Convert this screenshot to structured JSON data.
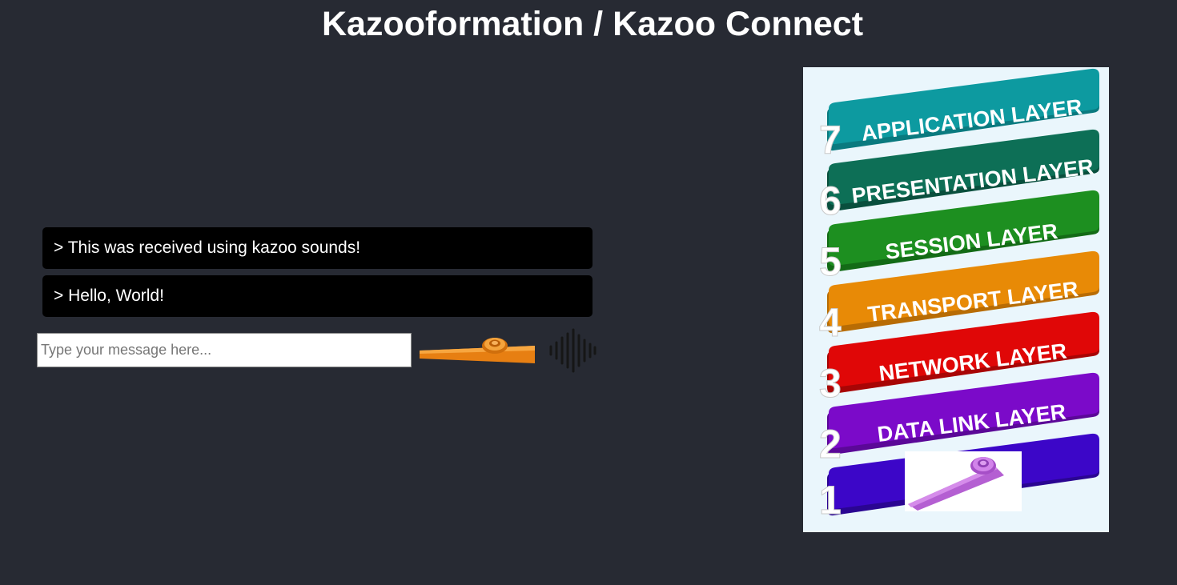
{
  "header": {
    "title": "Kazooformation / Kazoo Connect"
  },
  "chat": {
    "messages": [
      {
        "text": "> This was received using kazoo sounds!"
      },
      {
        "text": "> Hello, World!"
      }
    ],
    "input": {
      "value": "",
      "placeholder": "Type your message here..."
    },
    "send_icon": "kazoo-icon",
    "audio_icon": "sound-wave-icon"
  },
  "poster": {
    "layers": [
      {
        "number": "7",
        "label": "APPLICATION LAYER",
        "color": "#0d9aa0"
      },
      {
        "number": "6",
        "label": "PRESENTATION LAYER",
        "color": "#0d6f56"
      },
      {
        "number": "5",
        "label": "SESSION LAYER",
        "color": "#1d8f20"
      },
      {
        "number": "4",
        "label": "TRANSPORT LAYER",
        "color": "#e88a06"
      },
      {
        "number": "3",
        "label": "NETWORK LAYER",
        "color": "#e00707"
      },
      {
        "number": "2",
        "label": "DATA LINK LAYER",
        "color": "#7b0ac9"
      },
      {
        "number": "1",
        "label": "",
        "color": "#3c06c8"
      }
    ],
    "kazoo_image": "kazoo-purple-icon"
  },
  "colors": {
    "background": "#272a33",
    "message_background": "#000000",
    "kazoo_orange": "#f08a1c",
    "kazoo_purple": "#c86fe0"
  }
}
